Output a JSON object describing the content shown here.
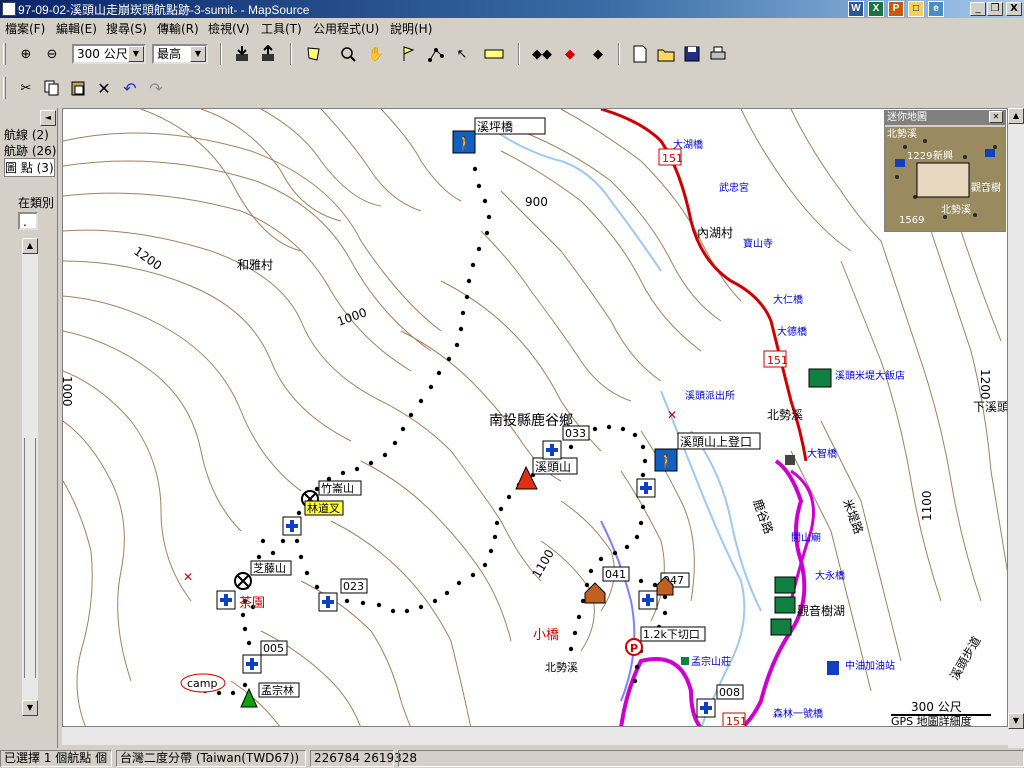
{
  "window": {
    "title": "97-09-02-溪頭山走崩崁頭航點跡-3-sumit- - MapSource",
    "app_icons": [
      "W",
      "X",
      "P"
    ],
    "controls": [
      "_",
      "❐",
      "X"
    ]
  },
  "menu": [
    "檔案(F)",
    "編輯(E)",
    "搜尋(S)",
    "傳輸(R)",
    "檢視(V)",
    "工具(T)",
    "公用程式(U)",
    "說明(H)"
  ],
  "toolbar": {
    "zoom_in_label": "⊕",
    "zoom_out_label": "⊖",
    "scale_value": "300 公尺",
    "detail_value": "最高"
  },
  "left_panel": {
    "tabs": [
      "航線 (2)",
      "航跡 (26)",
      "圖 點 (3)"
    ],
    "category_label": "在類別",
    "category_value": ".",
    "collapse_label": "◄"
  },
  "map": {
    "contours": [
      "1200",
      "1000",
      "900",
      "1100",
      "1100",
      "1200",
      "1000"
    ],
    "places": {
      "xitou_ping": "溪坪橋",
      "heya_village": "和雅村",
      "county": "南投縣鹿谷鄉",
      "xitou_shan": "溪頭山",
      "zhuhe_shan": "竹崙山",
      "linxiang": "林道叉",
      "zhiteng_shan": "芝藤山",
      "chayuan": "茶園",
      "camp": "camp",
      "bamboo_forest": "孟宗林",
      "xiaoqiao": "小橋",
      "beishixi_label": "北勢溪",
      "xitou_upper": "溪頭山上登口",
      "fork_label": "1.2k下切口",
      "p033": "033",
      "p023": "023",
      "p005": "005",
      "p041": "041",
      "p047": "047",
      "p008": "008",
      "dahu_bridge": "大湖橋",
      "wuchangong": "武忠宮",
      "neihu_village": "內湖村",
      "baoshan_temple": "寶山寺",
      "daren_bridge": "大仁橋",
      "dade_bridge": "大德橋",
      "beishixi": "北勢溪",
      "hotel": "溪頭米堤大飯店",
      "police": "溪頭派出所",
      "dazhi_bridge": "大智橋",
      "xiaxi": "下溪頭",
      "lukanlu": "鹿谷路",
      "mijilu": "米堤路",
      "kaishan_temple": "開山廟",
      "dayong_bridge": "大永橋",
      "guanyin_lake": "觀音樹湖",
      "mengzong": "孟宗山莊",
      "gas": "中油加油站",
      "senlin": "森林一號橋",
      "xitou_step": "溪頭步道",
      "route_151": "151",
      "scale_text": "300 公尺",
      "detail_text": "GPS 地圖詳細度",
      "elev_900": "900",
      "elev_1200": "1200",
      "elev_1100": "1100"
    },
    "track_color": "#000000",
    "road_color": "#cc0000",
    "boundary_color": "#cc00cc",
    "river_color": "#a0c8f0"
  },
  "minimap": {
    "title": "迷你地圖",
    "labels": [
      "北勢溪",
      "1229",
      "新興",
      "觀音樹",
      "1569",
      "北勢溪"
    ]
  },
  "status": {
    "selection": "已選擇 1 個航點 個",
    "datum": "台灣二度分帶 (Taiwan(TWD67))",
    "coords": "226784 2619328"
  }
}
